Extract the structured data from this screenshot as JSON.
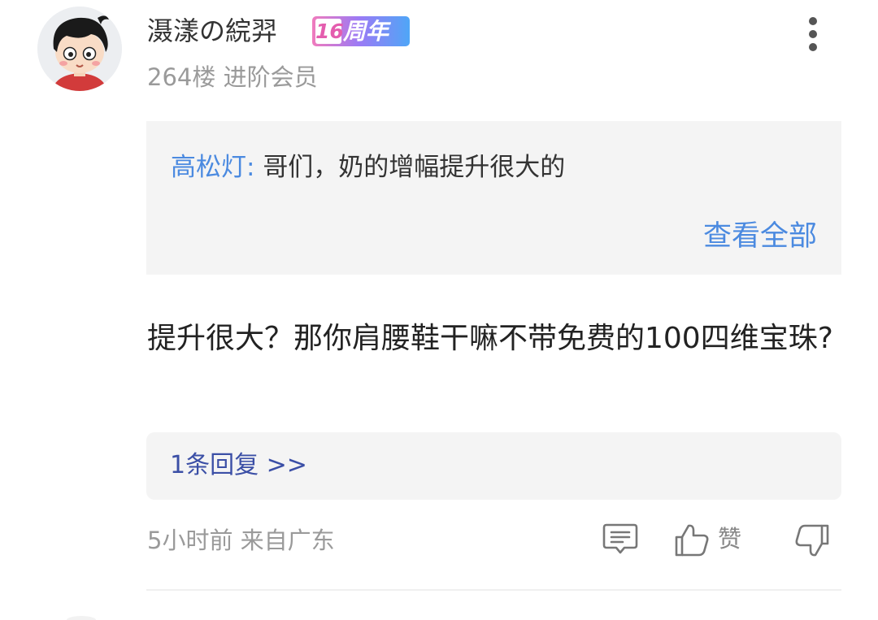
{
  "post": {
    "username": "滠漾の綄羿",
    "badge": {
      "number": "16",
      "label": "周年"
    },
    "floor": "264楼",
    "level": "进阶会员",
    "quote": {
      "author": "高松灯:",
      "content": "哥们，奶的增幅提升很大的",
      "view_all": "查看全部"
    },
    "comment": "提升很大？那你肩腰鞋干嘛不带免费的100四维宝珠?",
    "replies_link": "1条回复 >>",
    "time": "5小时前",
    "location": "来自广东",
    "like_label": "赞"
  },
  "icons": {
    "more": "more-vertical-icon",
    "reply": "comment-icon",
    "like": "thumbs-up-icon",
    "dislike": "thumbs-down-icon"
  },
  "colors": {
    "accent_blue": "#4b8ae0",
    "reply_link": "#3b4fa6",
    "muted_text": "#9a9a9a",
    "panel_bg": "#f4f4f4"
  }
}
